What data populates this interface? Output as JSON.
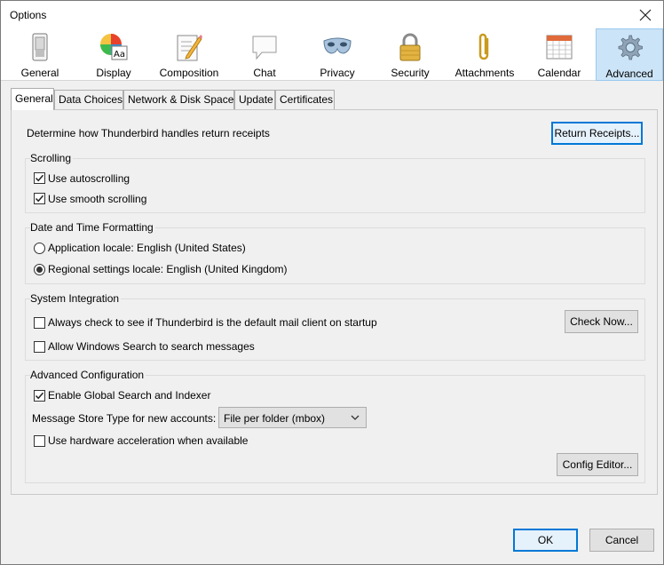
{
  "window": {
    "title": "Options"
  },
  "panes": [
    {
      "label": "General",
      "icon": "switch-icon"
    },
    {
      "label": "Display",
      "icon": "palette-icon"
    },
    {
      "label": "Composition",
      "icon": "compose-pencil-icon"
    },
    {
      "label": "Chat",
      "icon": "chat-bubble-icon"
    },
    {
      "label": "Privacy",
      "icon": "mask-icon"
    },
    {
      "label": "Security",
      "icon": "padlock-icon"
    },
    {
      "label": "Attachments",
      "icon": "paperclip-icon"
    },
    {
      "label": "Calendar",
      "icon": "calendar-icon"
    },
    {
      "label": "Advanced",
      "icon": "gear-icon",
      "selected": true
    }
  ],
  "tabs": [
    {
      "label": "General",
      "selected": true
    },
    {
      "label": "Data Choices"
    },
    {
      "label": "Network & Disk Space"
    },
    {
      "label": "Update"
    },
    {
      "label": "Certificates"
    }
  ],
  "receipts": {
    "text": "Determine how Thunderbird handles return receipts",
    "button": "Return Receipts..."
  },
  "scrolling": {
    "title": "Scrolling",
    "autoscroll": {
      "label": "Use autoscrolling",
      "checked": true
    },
    "smooth": {
      "label": "Use smooth scrolling",
      "checked": true
    }
  },
  "datetime": {
    "title": "Date and Time Formatting",
    "app_locale": {
      "label": "Application locale: English (United States)",
      "selected": false
    },
    "regional_locale": {
      "label": "Regional settings locale: English (United Kingdom)",
      "selected": true
    }
  },
  "system": {
    "title": "System Integration",
    "default_check": {
      "label": "Always check to see if Thunderbird is the default mail client on startup",
      "checked": false
    },
    "check_now": "Check Now...",
    "windows_search": {
      "label": "Allow Windows Search to search messages",
      "checked": false
    }
  },
  "advanced": {
    "title": "Advanced Configuration",
    "global_search": {
      "label": "Enable Global Search and Indexer",
      "checked": true
    },
    "store_label": "Message Store Type for new accounts:",
    "store_value": "File per folder (mbox)",
    "hw_accel": {
      "label": "Use hardware acceleration when available",
      "checked": false
    },
    "config_editor": "Config Editor..."
  },
  "footer": {
    "ok": "OK",
    "cancel": "Cancel"
  },
  "colors": {
    "selected_pane": "#cce4f7",
    "accent": "#0078d7"
  }
}
